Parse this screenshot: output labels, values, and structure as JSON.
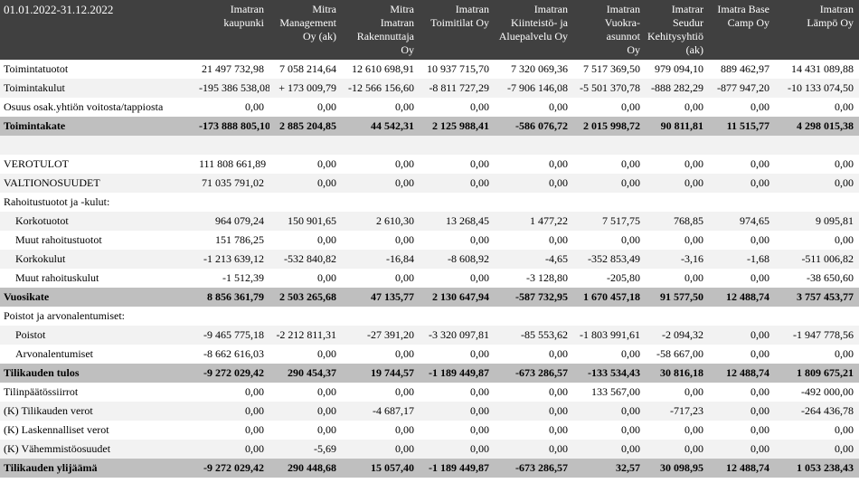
{
  "header": {
    "period": "01.01.2022-31.12.2022",
    "columns": [
      "Imatran\nkaupunki",
      "Mitra\nManagement\nOy (ak)",
      "Mitra\nImatran\nRakennuttaja\nOy",
      "Imatran\nToimitilat Oy",
      "Imatran\nKiinteistö- ja\nAluepalvelu Oy",
      "Imatran\nVuokra-\nasunnot\nOy",
      "Imatrar\nSeudur\nKehitysyhtiö\n(ak)",
      "Imatra Base\nCamp Oy",
      "Imatran\nLämpö Oy"
    ]
  },
  "rows": [
    {
      "label": "Toimintatuotot",
      "style": "plain",
      "values": [
        "21 497 732,98",
        "7 058 214,64",
        "12 610 698,91",
        "10 937 715,70",
        "7 320 069,36",
        "7 517 369,50",
        "979 094,10",
        "889 462,97",
        "14 431 089,88"
      ]
    },
    {
      "label": "Toimintakulut",
      "style": "alt",
      "values": [
        "-195 386 538,08",
        "+ 173 009,79",
        "-12 566 156,60",
        "-8 811 727,29",
        "-7 906 146,08",
        "-5 501 370,78",
        "-888 282,29",
        "-877 947,20",
        "-10 133 074,50"
      ]
    },
    {
      "label": "Osuus osak.yhtiön voitosta/tappiosta",
      "style": "plain",
      "values": [
        "0,00",
        "0,00",
        "0,00",
        "0,00",
        "0,00",
        "0,00",
        "0,00",
        "0,00",
        "0,00"
      ]
    },
    {
      "label": "Toimintakate",
      "style": "total",
      "values": [
        "-173 888 805,10",
        "2 885 204,85",
        "44 542,31",
        "2 125 988,41",
        "-586 076,72",
        "2 015 998,72",
        "90 811,81",
        "11 515,77",
        "4 298 015,38"
      ]
    },
    {
      "label": "",
      "style": "alt",
      "values": [
        "",
        "",
        "",
        "",
        "",
        "",
        "",
        "",
        ""
      ]
    },
    {
      "label": "VEROTULOT",
      "style": "plain",
      "values": [
        "111 808 661,89",
        "0,00",
        "0,00",
        "0,00",
        "0,00",
        "0,00",
        "0,00",
        "0,00",
        "0,00"
      ]
    },
    {
      "label": "VALTIONOSUUDET",
      "style": "alt",
      "values": [
        "71 035 791,02",
        "0,00",
        "0,00",
        "0,00",
        "0,00",
        "0,00",
        "0,00",
        "0,00",
        "0,00"
      ]
    },
    {
      "label": "Rahoitustuotot ja -kulut:",
      "style": "plain",
      "values": [
        "",
        "",
        "",
        "",
        "",
        "",
        "",
        "",
        ""
      ]
    },
    {
      "label": "Korkotuotot",
      "style": "alt",
      "indent": true,
      "values": [
        "964 079,24",
        "150 901,65",
        "2 610,30",
        "13 268,45",
        "1 477,22",
        "7 517,75",
        "768,85",
        "974,65",
        "9 095,81"
      ]
    },
    {
      "label": "Muut rahoitustuotot",
      "style": "plain",
      "indent": true,
      "values": [
        "151 786,25",
        "0,00",
        "0,00",
        "0,00",
        "0,00",
        "0,00",
        "0,00",
        "0,00",
        "0,00"
      ]
    },
    {
      "label": "Korkokulut",
      "style": "alt",
      "indent": true,
      "values": [
        "-1 213 639,12",
        "-532 840,82",
        "-16,84",
        "-8 608,92",
        "-4,65",
        "-352 853,49",
        "-3,16",
        "-1,68",
        "-511 006,82"
      ]
    },
    {
      "label": "Muut rahoituskulut",
      "style": "plain",
      "indent": true,
      "values": [
        "-1 512,39",
        "0,00",
        "0,00",
        "0,00",
        "-3 128,80",
        "-205,80",
        "0,00",
        "0,00",
        "-38 650,60"
      ]
    },
    {
      "label": "Vuosikate",
      "style": "total",
      "values": [
        "8 856 361,79",
        "2 503 265,68",
        "47 135,77",
        "2 130 647,94",
        "-587 732,95",
        "1 670 457,18",
        "91 577,50",
        "12 488,74",
        "3 757 453,77"
      ]
    },
    {
      "label": "Poistot ja arvonalentumiset:",
      "style": "plain",
      "values": [
        "",
        "",
        "",
        "",
        "",
        "",
        "",
        "",
        ""
      ]
    },
    {
      "label": "Poistot",
      "style": "alt",
      "indent": true,
      "values": [
        "-9 465 775,18",
        "-2 212 811,31",
        "-27 391,20",
        "-3 320 097,81",
        "-85 553,62",
        "-1 803 991,61",
        "-2 094,32",
        "0,00",
        "-1 947 778,56"
      ]
    },
    {
      "label": "Arvonalentumiset",
      "style": "plain",
      "indent": true,
      "values": [
        "-8 662 616,03",
        "0,00",
        "0,00",
        "0,00",
        "0,00",
        "0,00",
        "-58 667,00",
        "0,00",
        "0,00"
      ]
    },
    {
      "label": "Tilikauden tulos",
      "style": "total",
      "values": [
        "-9 272 029,42",
        "290 454,37",
        "19 744,57",
        "-1 189 449,87",
        "-673 286,57",
        "-133 534,43",
        "30 816,18",
        "12 488,74",
        "1 809 675,21"
      ]
    },
    {
      "label": "Tilinpäätössiirrot",
      "style": "plain",
      "values": [
        "0,00",
        "0,00",
        "0,00",
        "0,00",
        "0,00",
        "133 567,00",
        "0,00",
        "0,00",
        "-492 000,00"
      ]
    },
    {
      "label": "(K) Tilikauden verot",
      "style": "alt",
      "values": [
        "0,00",
        "0,00",
        "-4 687,17",
        "0,00",
        "0,00",
        "0,00",
        "-717,23",
        "0,00",
        "-264 436,78"
      ]
    },
    {
      "label": "(K) Laskennalliset verot",
      "style": "plain",
      "values": [
        "0,00",
        "0,00",
        "0,00",
        "0,00",
        "0,00",
        "0,00",
        "0,00",
        "0,00",
        "0,00"
      ]
    },
    {
      "label": "(K) Vähemmistöosuudet",
      "style": "alt",
      "values": [
        "0,00",
        "-5,69",
        "0,00",
        "0,00",
        "0,00",
        "0,00",
        "0,00",
        "0,00",
        "0,00"
      ]
    },
    {
      "label": "Tilikauden ylijäämä",
      "style": "total",
      "values": [
        "-9 272 029,42",
        "290 448,68",
        "15 057,40",
        "-1 189 449,87",
        "-673 286,57",
        "32,57",
        "30 098,95",
        "12 488,74",
        "1 053 238,43"
      ]
    }
  ]
}
